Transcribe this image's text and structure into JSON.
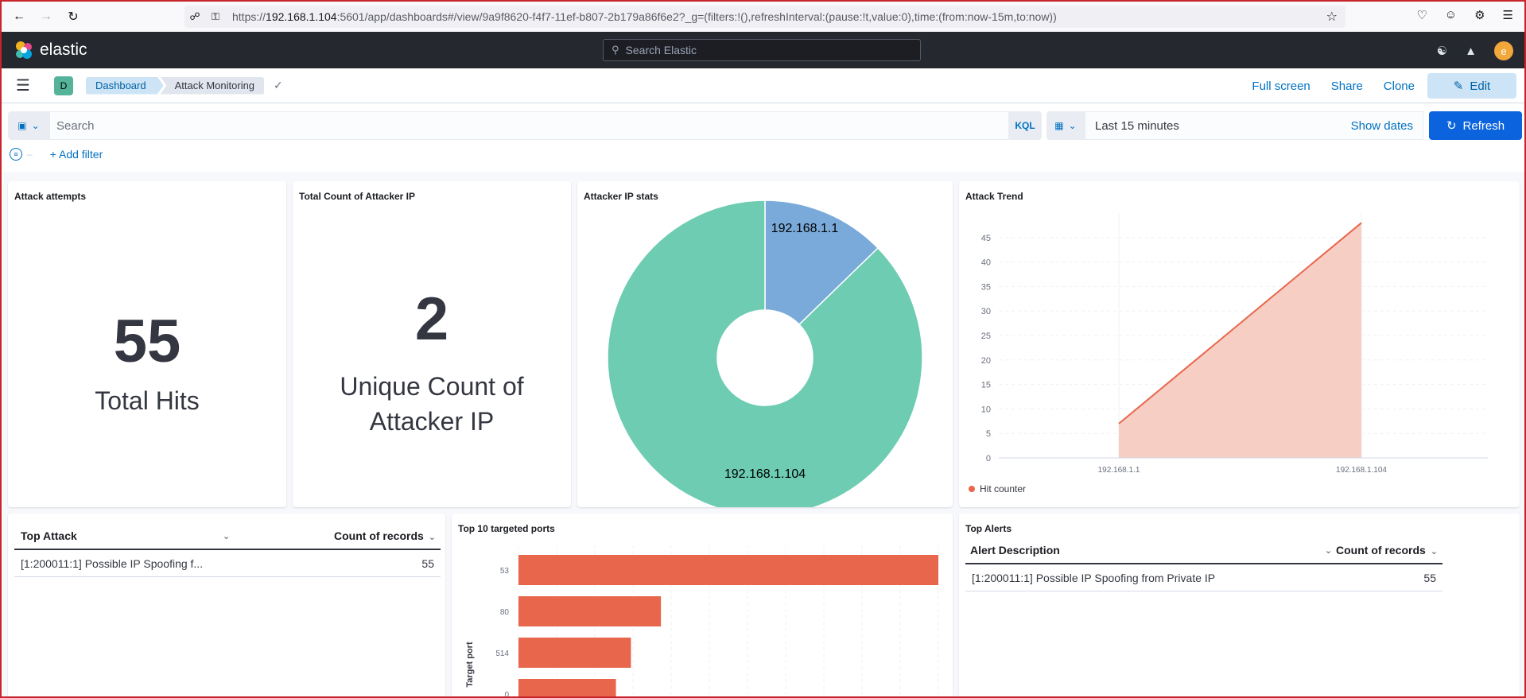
{
  "browser": {
    "url_prefix": "https://",
    "url_host": "192.168.1.104",
    "url_rest": ":5601/app/dashboards#/view/9a9f8620-f4f7-11ef-b807-2b179a86f6e2?_g=(filters:!(),refreshInterval:(pause:!t,value:0),time:(from:now-15m,to:now))"
  },
  "kibana": {
    "logo_text": "elastic",
    "search_placeholder": "Search Elastic",
    "avatar_letter": "e"
  },
  "breadcrumb": {
    "space_letter": "D",
    "items": [
      "Dashboard",
      "Attack Monitoring"
    ]
  },
  "actions": {
    "full_screen": "Full screen",
    "share": "Share",
    "clone": "Clone",
    "edit": "Edit"
  },
  "query": {
    "placeholder": "Search",
    "language": "KQL",
    "time_range": "Last 15 minutes",
    "show_dates": "Show dates",
    "refresh": "Refresh",
    "add_filter": "+ Add filter"
  },
  "panels": {
    "attack_attempts": {
      "title": "Attack attempts",
      "value": "55",
      "label": "Total Hits"
    },
    "unique_ip": {
      "title": "Total Count of Attacker IP",
      "value": "2",
      "label_line1": "Unique Count of",
      "label_line2": "Attacker IP"
    },
    "ip_stats": {
      "title": "Attacker IP stats"
    },
    "attack_trend": {
      "title": "Attack Trend",
      "legend": "Hit counter"
    },
    "top_attack": {
      "columns": [
        "Top Attack",
        "Count of records"
      ],
      "rows": [
        [
          "[1:200011:1] Possible IP Spoofing f...",
          "55"
        ]
      ]
    },
    "top_ports": {
      "title": "Top 10 targeted ports",
      "axis_label": "Target port"
    },
    "top_alerts": {
      "title": "Top Alerts",
      "columns": [
        "Alert Description",
        "Count of records"
      ],
      "rows": [
        [
          "[1:200011:1] Possible IP Spoofing from Private IP",
          "55"
        ]
      ]
    }
  },
  "colors": {
    "accent": "#0b64dd",
    "pie_large": "#6dccb1",
    "pie_small": "#79aad9",
    "trend": "#e7664c",
    "trend_fill": "#f6c5b8",
    "bar": "#e7664c"
  },
  "chart_data": [
    {
      "type": "pie",
      "title": "Attacker IP stats",
      "categories": [
        "192.168.1.1",
        "192.168.1.104"
      ],
      "values": [
        7,
        48
      ]
    },
    {
      "type": "area",
      "title": "Attack Trend",
      "categories": [
        "192.168.1.1",
        "192.168.1.104"
      ],
      "series": [
        {
          "name": "Hit counter",
          "values": [
            7,
            48
          ]
        }
      ],
      "ylim": [
        0,
        50
      ],
      "yticks": [
        0,
        5,
        10,
        15,
        20,
        25,
        30,
        35,
        40,
        45
      ],
      "grid": true,
      "legend": "bottom-left"
    },
    {
      "type": "bar",
      "orientation": "horizontal",
      "title": "Top 10 targeted ports",
      "ylabel": "Target port",
      "categories": [
        "53",
        "80",
        "514",
        "0"
      ],
      "values": [
        28,
        9.5,
        7.5,
        6.5
      ],
      "xlim": [
        0,
        28
      ],
      "grid": true
    }
  ]
}
